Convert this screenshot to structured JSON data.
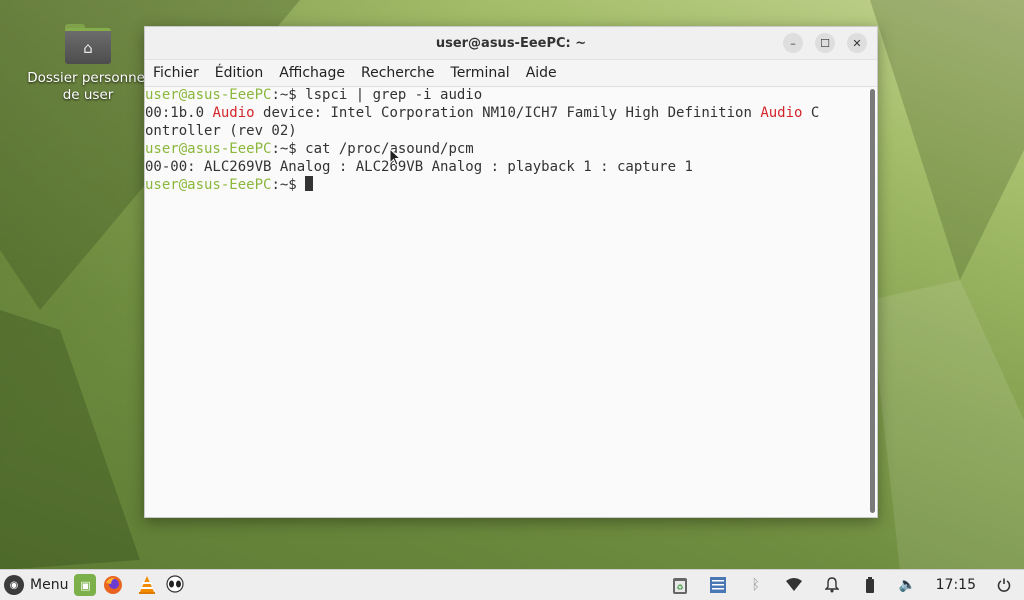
{
  "desktop": {
    "home_folder_label_line1": "Dossier personnel",
    "home_folder_label_line2": "de user"
  },
  "terminal": {
    "window_title": "user@asus-EeePC: ~",
    "menu": [
      "Fichier",
      "Édition",
      "Affichage",
      "Recherche",
      "Terminal",
      "Aide"
    ],
    "lines": [
      {
        "prompt": "user@asus-EeePC",
        "sep": ":~$ ",
        "cmd": "lspci | grep -i audio"
      },
      {
        "pre": "00:1b.0 ",
        "hl1": "Audio",
        "mid": " device: Intel Corporation NM10/ICH7 Family High Definition ",
        "hl2": "Audio",
        "post": " C"
      },
      {
        "text": "ontroller (rev 02)"
      },
      {
        "prompt": "user@asus-EeePC",
        "sep": ":~$ ",
        "cmd": "cat /proc/asound/pcm"
      },
      {
        "text": "00-00: ALC269VB Analog : ALC269VB Analog : playback 1 : capture 1"
      },
      {
        "prompt": "user@asus-EeePC",
        "sep": ":~$ ",
        "cmd": ""
      }
    ]
  },
  "taskbar": {
    "menu_label": "Menu",
    "clock": "17:15"
  },
  "colors": {
    "prompt": "#8ab73c",
    "highlight": "#d3262b"
  }
}
